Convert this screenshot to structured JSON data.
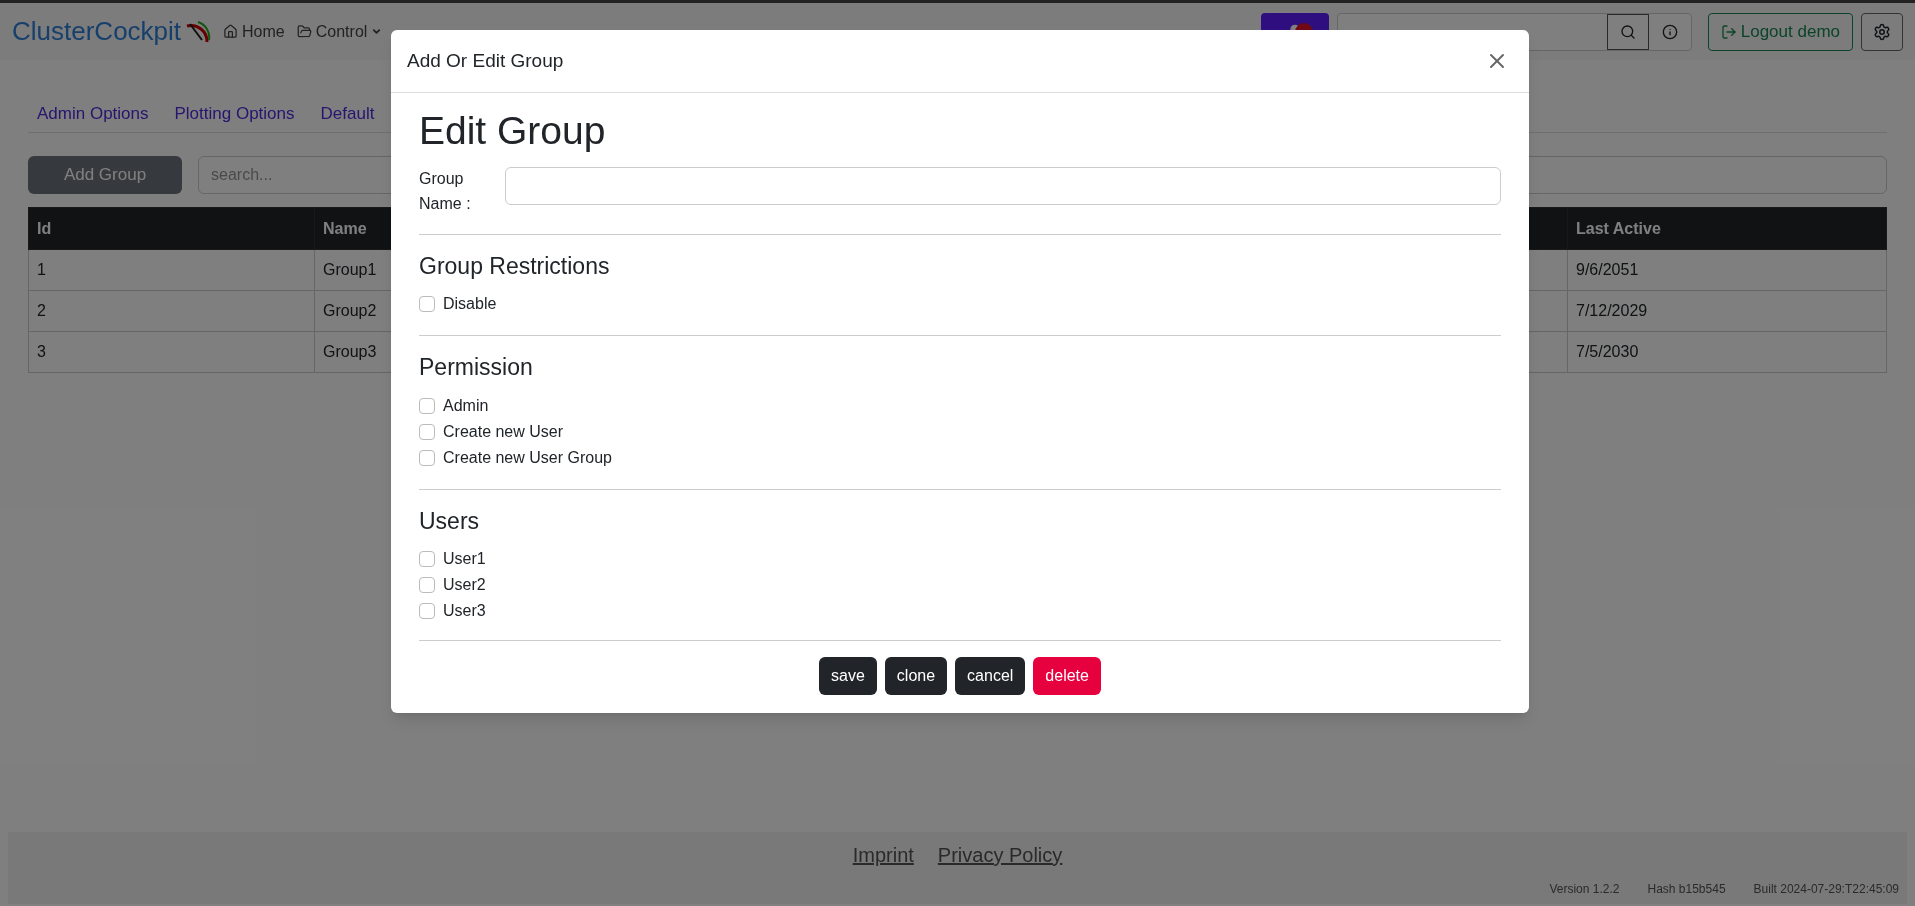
{
  "navbar": {
    "brand": "ClusterCockpit",
    "items": [
      {
        "label": "Home",
        "dropdown": false
      },
      {
        "label": "Control",
        "dropdown": true
      }
    ],
    "logout": "Logout demo"
  },
  "tabs": [
    {
      "label": "Admin Options",
      "selected": false
    },
    {
      "label": "Plotting Options",
      "selected": false
    },
    {
      "label": "Default",
      "selected": false
    }
  ],
  "toolbar": {
    "add_button": "Add Group",
    "search": {
      "placeholder": "search..."
    }
  },
  "table": {
    "columns": [
      "Id",
      "Name",
      "Last Active"
    ],
    "rows": [
      [
        "1",
        "Group1",
        "9/6/2051"
      ],
      [
        "2",
        "Group2",
        "7/12/2029"
      ],
      [
        "3",
        "Group3",
        "7/5/2030"
      ]
    ]
  },
  "modal": {
    "title": "Add Or Edit Group",
    "heading": "Edit Group",
    "group_name_label": "Group Name :",
    "sections": [
      {
        "title": "Group Restrictions",
        "options": [
          {
            "label": "Disable",
            "checked": false
          }
        ]
      },
      {
        "title": "Permission",
        "options": [
          {
            "label": "Admin",
            "checked": false
          },
          {
            "label": "Create new User",
            "checked": false
          },
          {
            "label": "Create new User Group",
            "checked": false
          }
        ]
      },
      {
        "title": "Users",
        "options": [
          {
            "label": "User1",
            "checked": false
          },
          {
            "label": "User2",
            "checked": false
          },
          {
            "label": "User3",
            "checked": false
          }
        ]
      }
    ],
    "buttons": [
      {
        "label": "save",
        "kind": "dark"
      },
      {
        "label": "clone",
        "kind": "dark"
      },
      {
        "label": "cancel",
        "kind": "dark"
      },
      {
        "label": "delete",
        "kind": "danger"
      }
    ]
  },
  "footer": {
    "links": [
      "Imprint",
      "Privacy Policy"
    ],
    "info": [
      "Version 1.2.2",
      "Hash b15b545",
      "Built 2024-07-29:T22:45:09"
    ]
  }
}
